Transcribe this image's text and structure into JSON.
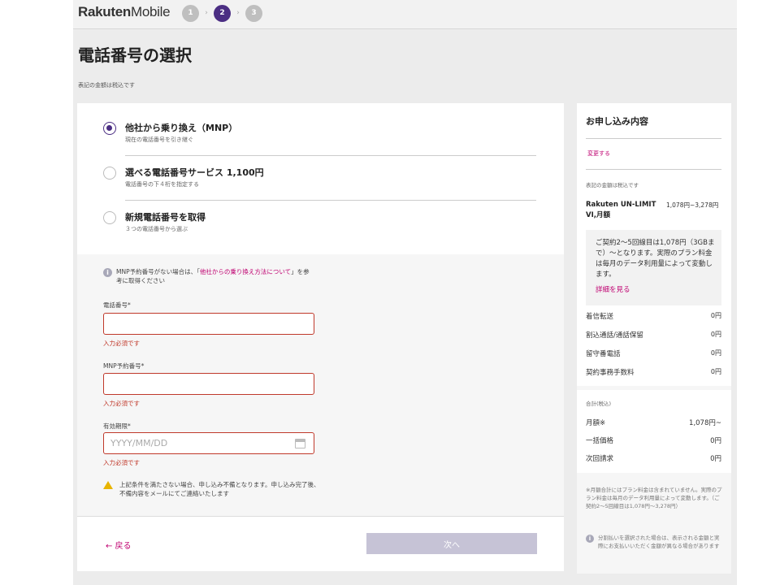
{
  "header": {
    "brand": "Rakuten",
    "product": "Mobile",
    "steps": [
      "1",
      "2",
      "3"
    ],
    "active_step": 2,
    "step_sep": "›"
  },
  "page": {
    "title": "電話番号の選択",
    "tax_note": "表記の金額は税込です"
  },
  "options": [
    {
      "title": "他社から乗り換え（MNP）",
      "sub": "現在の電話番号を引き継ぐ",
      "selected": true
    },
    {
      "title": "選べる電話番号サービス 1,100円",
      "sub": "電話番号の下４桁を指定する",
      "selected": false
    },
    {
      "title": "新規電話番号を取得",
      "sub": "３つの電話番号から選ぶ",
      "selected": false
    }
  ],
  "form": {
    "info_icon": "i",
    "info_prefix": "MNP予約番号がない場合は、「",
    "info_link": "他社からの乗り換え方法について",
    "info_suffix": "」を参考に取得ください",
    "phone_label": "電話番号*",
    "phone_value": "",
    "phone_error": "入力必須です",
    "mnp_label": "MNP予約番号*",
    "mnp_value": "",
    "mnp_error": "入力必須です",
    "expiry_label": "有効期限*",
    "expiry_placeholder": "YYYY/MM/DD",
    "expiry_error": "入力必須です",
    "warning": "上記条件を満たさない場合、申し込み不備となります。申し込み完了後、不備内容をメールにてご連絡いたします"
  },
  "nav": {
    "back_label": "← 戻る",
    "next_label": "次へ"
  },
  "sidebar": {
    "title": "お申し込み内容",
    "change_label": "変更する",
    "tax_note": "表記の金額は税込です",
    "plan_name": "Rakuten UN-LIMIT VI,月額",
    "plan_price": "1,078円~3,278円",
    "note": "ご契約2～5回線目は1,078円（3GBまで）～となります。実際のプラン料金は毎月のデータ利用量によって変動します。",
    "note_link": "詳細を見る",
    "fees": [
      {
        "name": "着信転送",
        "value": "0円"
      },
      {
        "name": "割込通話/通話保留",
        "value": "0円"
      },
      {
        "name": "留守番電話",
        "value": "0円"
      },
      {
        "name": "契約事務手数料",
        "value": "0円"
      }
    ],
    "total_header": "合計(税込)",
    "totals": [
      {
        "name": "月額※",
        "value": "1,078円~"
      },
      {
        "name": "一括価格",
        "value": "0円"
      },
      {
        "name": "次回請求",
        "value": "0円"
      }
    ],
    "disclaimer": "※月額合計にはプラン料金は含まれていません。実際のプラン料金は毎月のデータ利用量によって変動します。（ご契約2～5回線目は1,078円～3,278円）",
    "installment_icon": "i",
    "installment_note": "分割払いを選択された場合は、表示される金額と実際にお支払いいただく金額が異なる場合があります"
  }
}
